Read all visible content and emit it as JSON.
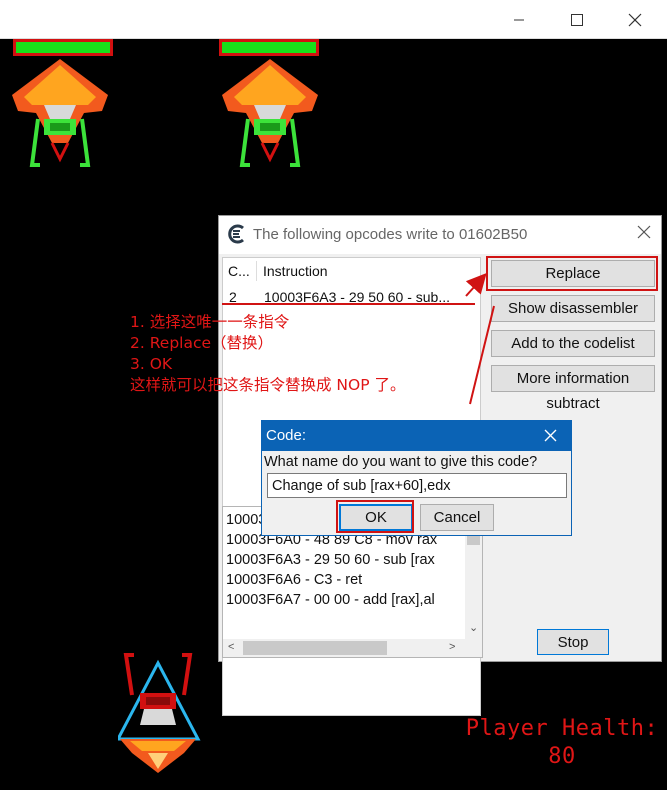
{
  "window": {
    "minimize_icon": "minimize-icon",
    "maximize_icon": "maximize-icon",
    "close_icon": "close-icon"
  },
  "game": {
    "player_health_label": "Player Health:",
    "player_health_value": "80",
    "colors": {
      "background": "#000000",
      "health_bar_fill": "#18e01a",
      "health_bar_border": "#d21010",
      "player_health_text": "#e01616"
    }
  },
  "ce_dialog": {
    "title": "The following opcodes write to 01602B50",
    "columns": [
      "C...",
      "Instruction"
    ],
    "rows": [
      {
        "count": "2",
        "instruction": "10003F6A3 - 29 50 60  - sub..."
      }
    ],
    "buttons": {
      "replace": "Replace",
      "show_disassembler": "Show disassembler",
      "add_to_codelist": "Add to the codelist",
      "more_information": "More information",
      "stop": "Stop"
    },
    "status": "subtract",
    "disassembly": [
      "10003F6",
      "10003F6A0 - 48 89 C8  - mov rax",
      "10003F6A3 - 29 50 60  - sub [rax",
      "10003F6A6 - C3 - ret",
      "10003F6A7 - 00 00  - add [rax],al"
    ]
  },
  "code_dialog": {
    "title": "Code:",
    "prompt": "What name do you want to give this code?",
    "input_value": "Change of sub [rax+60],edx",
    "ok": "OK",
    "cancel": "Cancel"
  },
  "annotation": {
    "lines": [
      "1. 选择这唯一一条指令",
      "2. Replace（替换）",
      "3. OK",
      "这样就可以把这条指令替换成 NOP 了。"
    ],
    "color": "#e01616"
  }
}
